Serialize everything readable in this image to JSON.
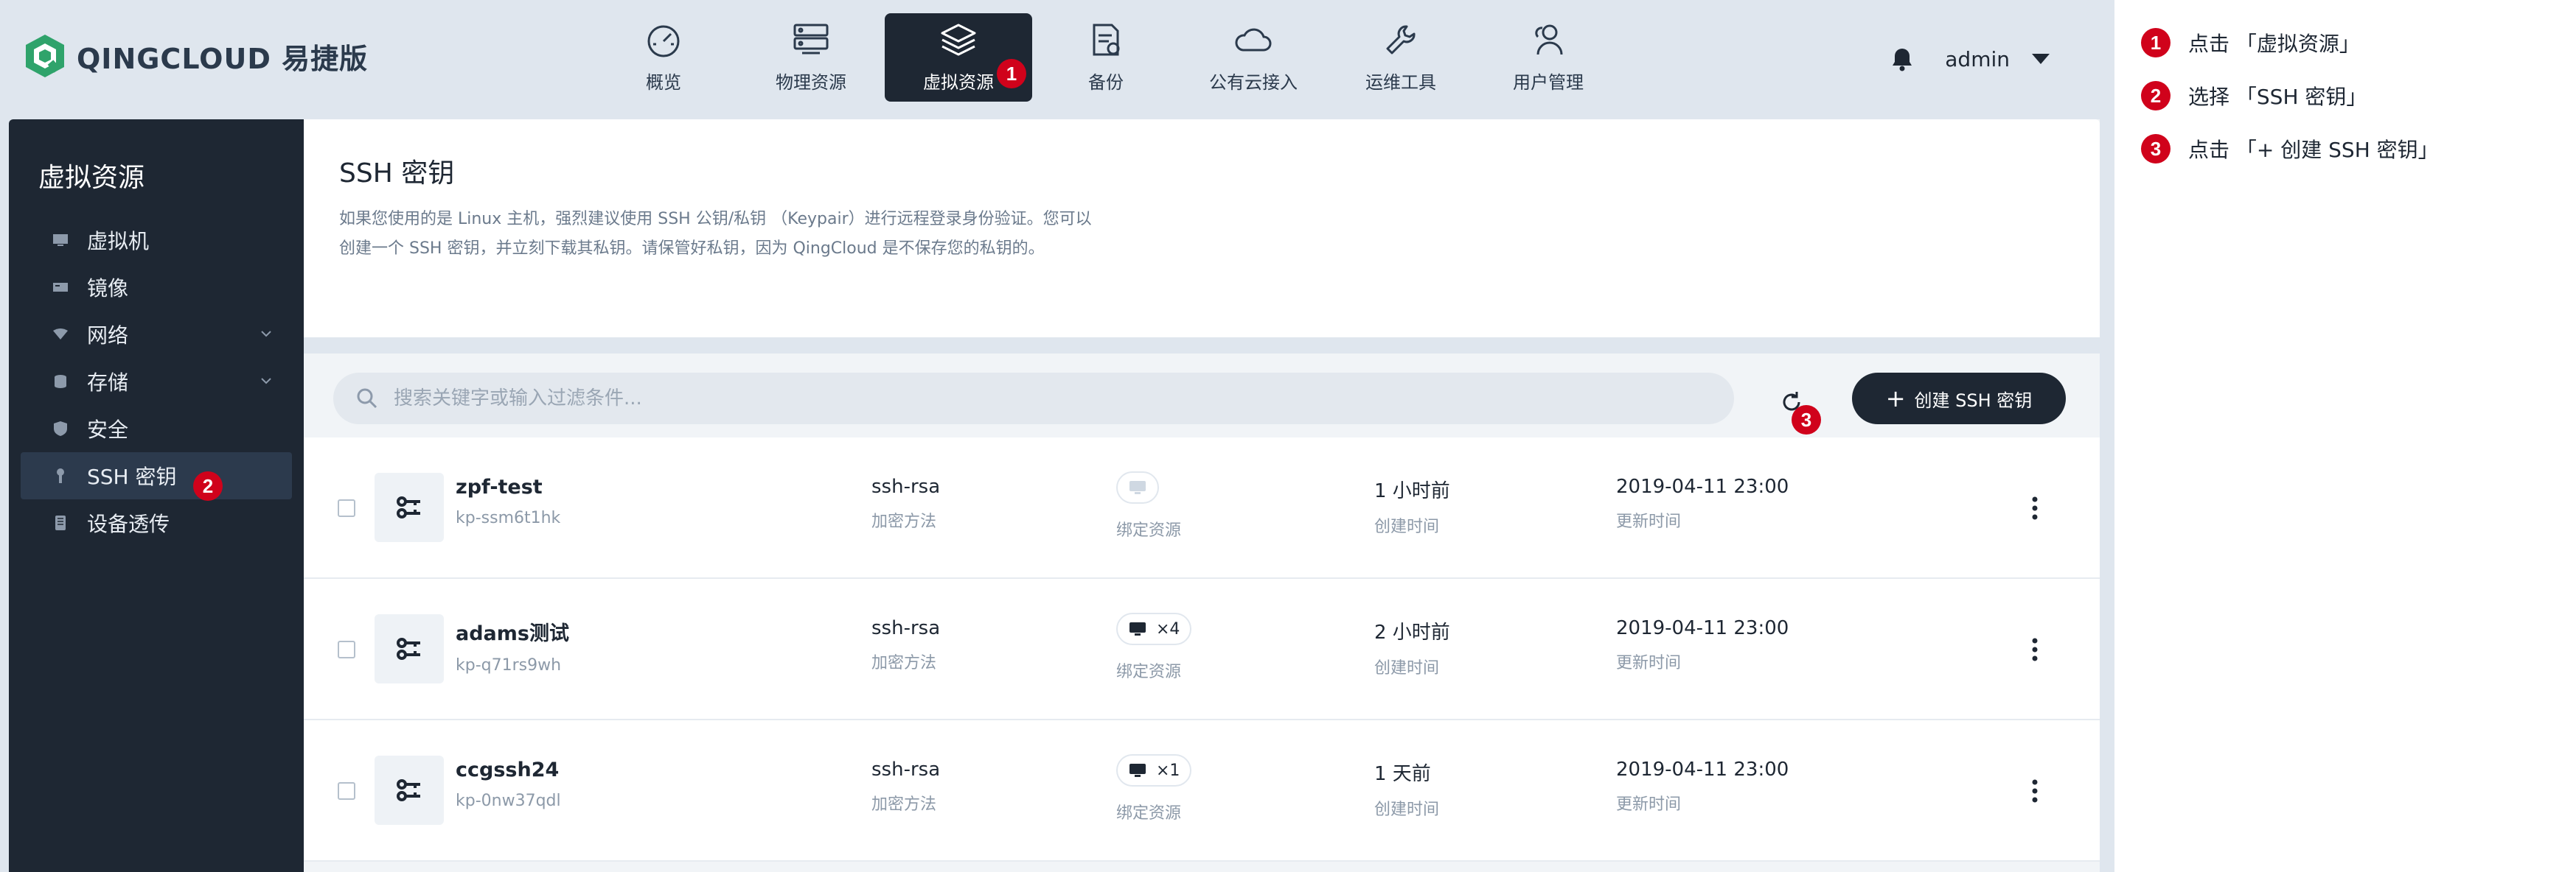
{
  "app": {
    "brand": "QINGCLOUD 易捷版",
    "nav": [
      {
        "label": "概览",
        "icon": "dashboard-gauge-icon"
      },
      {
        "label": "物理资源",
        "icon": "server-icon"
      },
      {
        "label": "虚拟资源",
        "icon": "layers-icon",
        "active": true,
        "marker": "1"
      },
      {
        "label": "备份",
        "icon": "backup-document-icon"
      },
      {
        "label": "公有云接入",
        "icon": "cloud-icon"
      },
      {
        "label": "运维工具",
        "icon": "wrench-icon"
      },
      {
        "label": "用户管理",
        "icon": "user-group-icon"
      }
    ],
    "user": {
      "name": "admin"
    }
  },
  "sidebar": {
    "title": "虚拟资源",
    "items": [
      {
        "label": "虚拟机",
        "icon": "monitor-icon"
      },
      {
        "label": "镜像",
        "icon": "image-icon"
      },
      {
        "label": "网络",
        "icon": "network-icon",
        "expandable": true
      },
      {
        "label": "存储",
        "icon": "storage-icon",
        "expandable": true
      },
      {
        "label": "安全",
        "icon": "shield-icon"
      },
      {
        "label": "SSH 密钥",
        "icon": "key-icon",
        "active": true,
        "marker": "2"
      },
      {
        "label": "设备透传",
        "icon": "device-icon"
      }
    ]
  },
  "main": {
    "title": "SSH 密钥",
    "description_line1": "如果您使用的是 Linux 主机，强烈建议使用 SSH 公钥/私钥 （Keypair）进行远程登录身份验证。您可以",
    "description_line2": "创建一个 SSH 密钥，并立刻下载其私钥。请保管好私钥，因为 QingCloud 是不保存您的私钥的。",
    "search_placeholder": "搜索关键字或输入过滤条件...",
    "refresh_marker": "3",
    "create_button": "创建 SSH 密钥",
    "create_button_plus": "+",
    "rows": [
      {
        "name": "zpf-test",
        "id": "kp-ssm6t1hk",
        "algo": "ssh-rsa",
        "algo_label": "加密方法",
        "bind_count": "",
        "bind_label": "绑定资源",
        "created": "1 小时前",
        "created_label": "创建时间",
        "updated": "2019-04-11 23:00",
        "updated_label": "更新时间"
      },
      {
        "name": "adams测试",
        "id": "kp-q71rs9wh",
        "algo": "ssh-rsa",
        "algo_label": "加密方法",
        "bind_count": "×4",
        "bind_label": "绑定资源",
        "created": "2 小时前",
        "created_label": "创建时间",
        "updated": "2019-04-11 23:00",
        "updated_label": "更新时间"
      },
      {
        "name": "ccgssh24",
        "id": "kp-0nw37qdl",
        "algo": "ssh-rsa",
        "algo_label": "加密方法",
        "bind_count": "×1",
        "bind_label": "绑定资源",
        "created": "1 天前",
        "created_label": "创建时间",
        "updated": "2019-04-11 23:00",
        "updated_label": "更新时间"
      }
    ]
  },
  "steps": [
    {
      "num": "1",
      "text": "点击 「虚拟资源」"
    },
    {
      "num": "2",
      "text": "选择 「SSH 密钥」"
    },
    {
      "num": "3",
      "text": "点击 「+ 创建 SSH 密钥」"
    }
  ],
  "colors": {
    "dark": "#1e2733",
    "marker": "#d0021b",
    "bg": "#dfe6ee",
    "brand_green": "#2fa36b"
  }
}
